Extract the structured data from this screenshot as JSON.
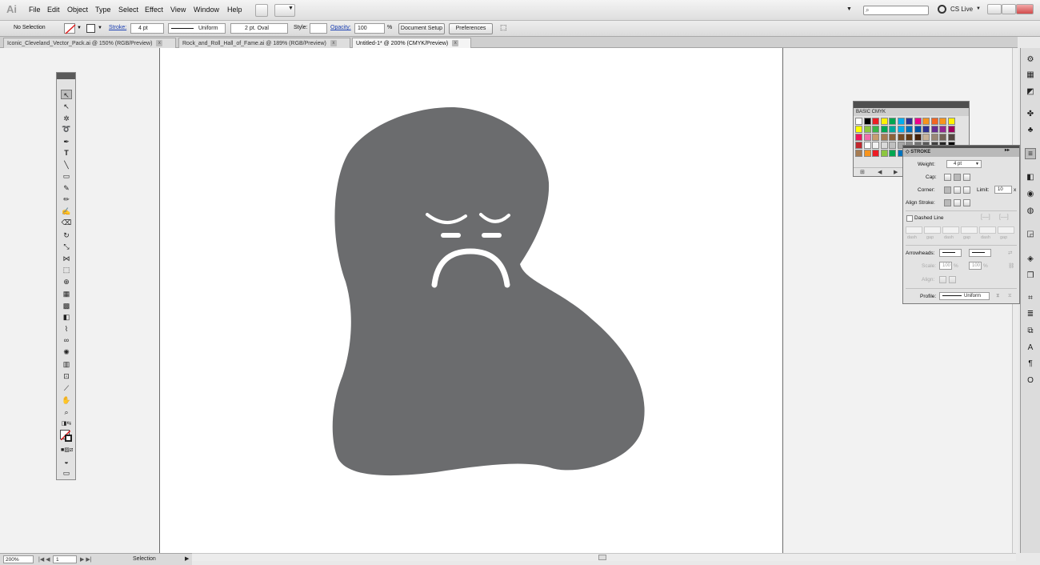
{
  "app": {
    "logo": "Ai"
  },
  "menu": [
    "File",
    "Edit",
    "Object",
    "Type",
    "Select",
    "Effect",
    "View",
    "Window",
    "Help"
  ],
  "search": {
    "value": ""
  },
  "cs_live": "CS Live",
  "control": {
    "selection": "No Selection",
    "stroke_label": "Stroke:",
    "stroke_weight": "4 pt",
    "profile": "Uniform",
    "brush": "2 pt. Oval",
    "style_label": "Style:",
    "opacity_label": "Opacity:",
    "opacity_value": "100",
    "percent": "%",
    "document_setup": "Document Setup",
    "preferences": "Preferences"
  },
  "tabs": [
    {
      "label": "Iconic_Cleveland_Vector_Pack.ai @ 150% (RGB/Preview)",
      "close": "x"
    },
    {
      "label": "Rock_and_Roll_Hall_of_Fame.ai @ 189% (RGB/Preview)",
      "close": "x"
    },
    {
      "label": "Untitled-1* @ 200% (CMYK/Preview)",
      "close": "x"
    }
  ],
  "colors": {
    "shape": "#6b6c6e",
    "face": "#ffffff"
  },
  "swatches": {
    "title": "BASIC CMYK",
    "colors": [
      "#ffffff",
      "#000000",
      "#ed1c24",
      "#fff200",
      "#00a651",
      "#00aeef",
      "#2e3192",
      "#ec008c",
      "#f7941d",
      "#f26522",
      "#f7941d",
      "#fff200",
      "#ffff00",
      "#8dc63f",
      "#39b54a",
      "#00a651",
      "#00a99d",
      "#00aeef",
      "#0072bc",
      "#0054a6",
      "#2e3192",
      "#662d91",
      "#92278f",
      "#9e005d",
      "#ee145b",
      "#f06eaa",
      "#c69c6d",
      "#a67c52",
      "#8c6239",
      "#754c24",
      "#603913",
      "#42210b",
      "#c7b299",
      "#998675",
      "#736357",
      "#534741",
      "#c1272d",
      "#ffffff",
      "#f2f2f2",
      "#d9d9d9",
      "#bfbfbf",
      "#a6a6a6",
      "#8c8c8c",
      "#737373",
      "#595959",
      "#404040",
      "#262626",
      "#000000",
      "#a67c52",
      "#f7941d",
      "#ed1c24",
      "#8dc63f",
      "#00a651",
      "#0072bc",
      "#92278f",
      "#ec008c"
    ]
  },
  "stroke_panel": {
    "title": "◇ STROKE",
    "weight_label": "Weight:",
    "weight_value": "4 pt",
    "cap_label": "Cap:",
    "corner_label": "Corner:",
    "limit_label": "Limit:",
    "limit_value": "10",
    "limit_unit": "x",
    "align_label": "Align Stroke:",
    "dashed_label": "Dashed Line",
    "dash_labels": [
      "dash",
      "gap",
      "dash",
      "gap",
      "dash",
      "gap"
    ],
    "arrowheads_label": "Arrowheads:",
    "scale_label": "Scale:",
    "scale_a": "100",
    "scale_b": "100",
    "pct": "%",
    "align_label2": "Align:",
    "profile_label": "Profile:",
    "profile_value": "Uniform"
  },
  "status": {
    "zoom": "200%",
    "page": "1",
    "mode": "Selection"
  }
}
